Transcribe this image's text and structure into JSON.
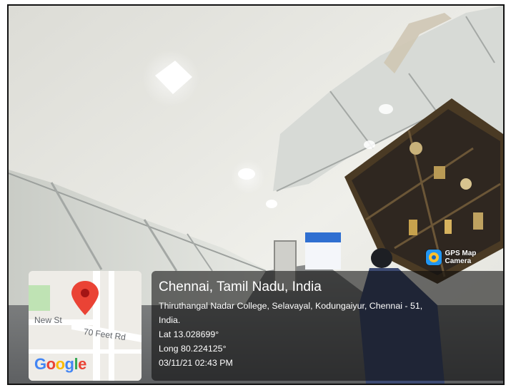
{
  "watermark": {
    "app_name": "GPS Map Camera",
    "icon": "gps-map-camera-logo-icon"
  },
  "map": {
    "streets": [
      "New St",
      "70 Feet Rd"
    ],
    "logo_text": [
      "G",
      "o",
      "o",
      "g",
      "l",
      "e"
    ],
    "pin_icon": "map-pin-icon",
    "colors": {
      "road": "#ffffff",
      "park": "#bfe3b4",
      "land": "#eeece7",
      "pin": "#ea4335"
    }
  },
  "location": {
    "city": "Chennai, Tamil Nadu, India",
    "address_line1": "Thiruthangal Nadar College, Selavayal, Kodungaiyur, Chennai - 51,",
    "address_line2": "India.",
    "latitude": "Lat 13.028699°",
    "longitude": "Long 80.224125°",
    "datetime": "03/11/21 02:43 PM"
  }
}
